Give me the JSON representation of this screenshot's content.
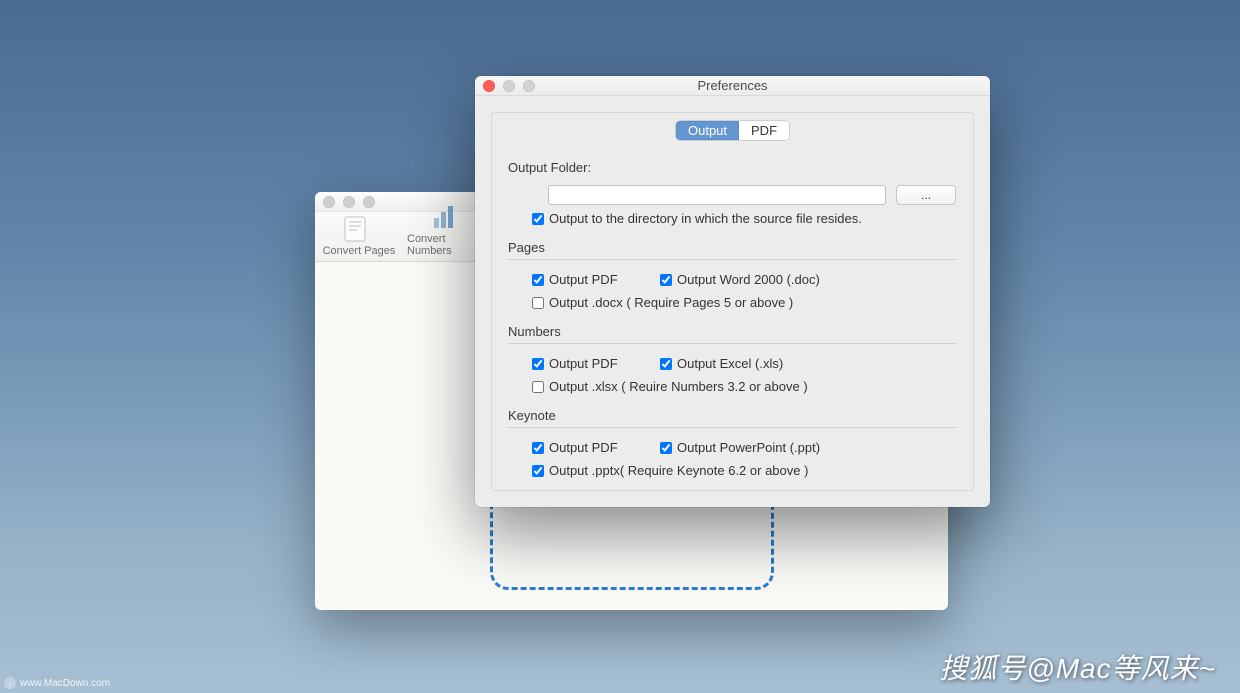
{
  "back_window": {
    "toolbar_items": [
      "Convert Pages",
      "Convert Numbers"
    ]
  },
  "pref": {
    "title": "Preferences",
    "tabs": {
      "output": "Output",
      "pdf": "PDF"
    },
    "output_folder_label": "Output Folder:",
    "folder_path": "",
    "browse_button": "...",
    "output_to_source": {
      "label": "Output to the directory in which the source file resides.",
      "checked": true
    },
    "pages": {
      "title": "Pages",
      "output_pdf": {
        "label": "Output PDF",
        "checked": true
      },
      "output_word": {
        "label": "Output Word 2000 (.doc)",
        "checked": true
      },
      "output_docx": {
        "label": "Output .docx ( Require Pages 5 or above )",
        "checked": false
      }
    },
    "numbers": {
      "title": "Numbers",
      "output_pdf": {
        "label": "Output PDF",
        "checked": true
      },
      "output_excel": {
        "label": "Output Excel (.xls)",
        "checked": true
      },
      "output_xlsx": {
        "label": "Output .xlsx ( Reuire Numbers 3.2 or above )",
        "checked": false
      }
    },
    "keynote": {
      "title": "Keynote",
      "output_pdf": {
        "label": "Output PDF",
        "checked": true
      },
      "output_ppt": {
        "label": "Output PowerPoint (.ppt)",
        "checked": true
      },
      "output_pptx": {
        "label": "Output .pptx( Require Keynote 6.2 or above )",
        "checked": true
      }
    }
  },
  "watermark": "搜狐号@Mac等风来~",
  "credit": "www.MacDown.com"
}
